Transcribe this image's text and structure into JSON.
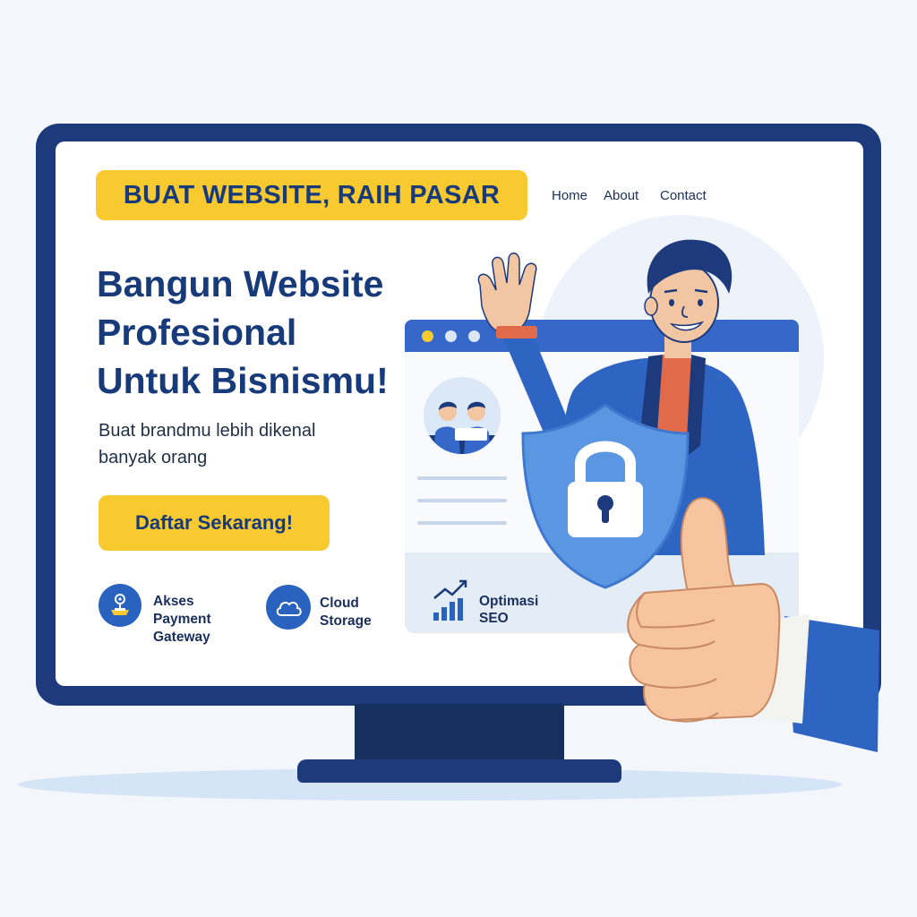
{
  "headline": "BUAT WEBSITE, RAIH PASAR",
  "nav": {
    "home": "Home",
    "about": "About",
    "contact": "Contact"
  },
  "hero": {
    "title_lines": [
      "Bangun Website",
      "Profesional",
      "Untuk Bisnismu!"
    ],
    "subtitle_lines": [
      "Buat brandmu lebih dikenal",
      "banyak orang"
    ]
  },
  "cta": {
    "label": "Daftar Sekarang!"
  },
  "features": [
    {
      "icon": "payment-gateway-icon",
      "lines": [
        "Akses",
        "Payment",
        "Gateway"
      ]
    },
    {
      "icon": "cloud-icon",
      "lines": [
        "Cloud",
        "Storage"
      ]
    },
    {
      "icon": "seo-chart-icon",
      "lines": [
        "Optimasi",
        "SEO"
      ]
    }
  ],
  "colors": {
    "brand_navy": "#173a7a",
    "accent_yellow": "#f9c930",
    "primary_blue": "#3568c8",
    "shield_blue": "#5b96e2"
  },
  "illustration": {
    "elements": [
      "waving-man",
      "security-shield-lock",
      "thumbs-up-hand",
      "team-avatar",
      "browser-window"
    ]
  }
}
